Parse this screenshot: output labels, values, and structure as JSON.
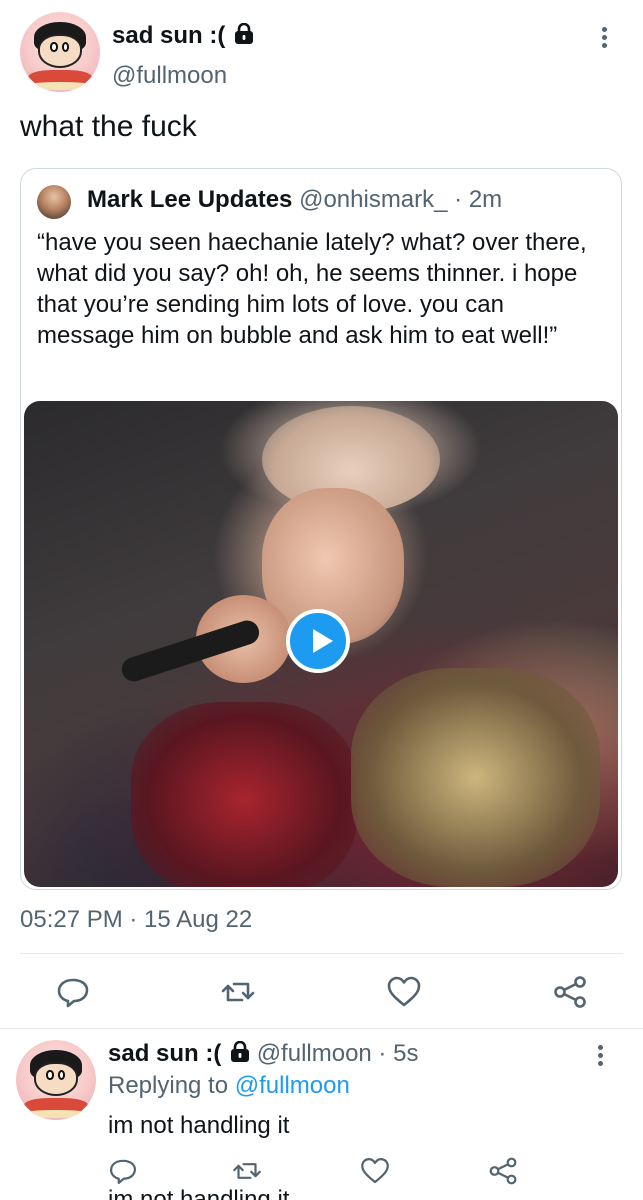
{
  "main_tweet": {
    "display_name": "sad sun :(",
    "handle": "@fullmoon",
    "text": "what the fuck",
    "timestamp": "05:27 PM · 15 Aug 22"
  },
  "quoted_tweet": {
    "display_name": "Mark Lee Updates",
    "meta": "@onhismark_ · 2m",
    "text": "“have you seen haechanie lately? what? over there, what did you say? oh! oh, he seems thinner. i hope that you’re sending him lots of love. you can message him on bubble and ask him to eat well!”",
    "media": {
      "type": "video",
      "icon": "play-icon"
    }
  },
  "actions": [
    "reply-icon",
    "retweet-icon",
    "like-icon",
    "share-icon"
  ],
  "reply_tweet": {
    "display_name": "sad sun :(",
    "handle_time": "@fullmoon · 5s",
    "replying_prefix": "Replying to",
    "replying_handle": "@fullmoon",
    "text": "im not handling it"
  },
  "next_tweet_peek": "im not handling it",
  "colors": {
    "accent": "#1d9bf0",
    "secondary_text": "#536471",
    "border": "#cfd9de"
  }
}
